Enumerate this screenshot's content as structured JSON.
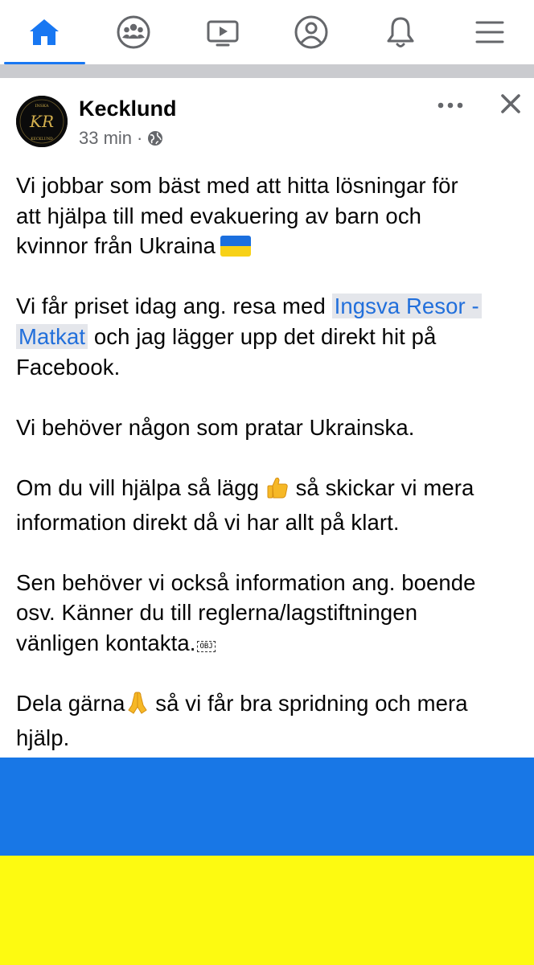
{
  "nav": {
    "tabs": [
      {
        "icon": "home-icon",
        "active": true
      },
      {
        "icon": "groups-icon",
        "active": false
      },
      {
        "icon": "watch-icon",
        "active": false
      },
      {
        "icon": "profile-icon",
        "active": false
      },
      {
        "icon": "notifications-icon",
        "active": false
      },
      {
        "icon": "menu-icon",
        "active": false
      }
    ],
    "accent": "#1877f2"
  },
  "post": {
    "author": "Kecklund",
    "time": "33 min",
    "separator": "·",
    "audience_icon": "globe-icon",
    "avatar_text_top": "INSKA",
    "avatar_text_bottom": "KECKLUND",
    "avatar_monogram": "KR",
    "body": {
      "p1": {
        "l1": "Vi jobbar som bäst med att hitta lösningar för",
        "l2": "att hjälpa till med evakuering av barn och",
        "l3": "kvinnor från Ukraina"
      },
      "p2": {
        "l1_text": "Vi får priset idag ang. resa med ",
        "l1_mention": "Ingsva Resor -",
        "l2_mention": "Matkat",
        "l2_text": " och jag lägger upp det direkt hit på",
        "l3": "Facebook."
      },
      "p3": {
        "l1": "Vi behöver någon som pratar Ukrainska."
      },
      "p4": {
        "l1_a": "Om du vill hjälpa så lägg ",
        "l1_b": " så skickar vi mera",
        "l2": "information direkt då vi har allt på klart."
      },
      "p5": {
        "l1": "Sen behöver vi också information ang. boende",
        "l2": "osv. Känner du till reglerna/lagstiftningen",
        "l3": "vänligen kontakta.",
        "obj": "OBJ"
      },
      "p6": {
        "l1_a": "Dela gärna",
        "l1_b": " så vi får bra spridning och mera",
        "l2": "hjälp."
      }
    },
    "image": {
      "colors": {
        "top": "#1877e6",
        "bottom": "#fdfa11"
      }
    }
  }
}
